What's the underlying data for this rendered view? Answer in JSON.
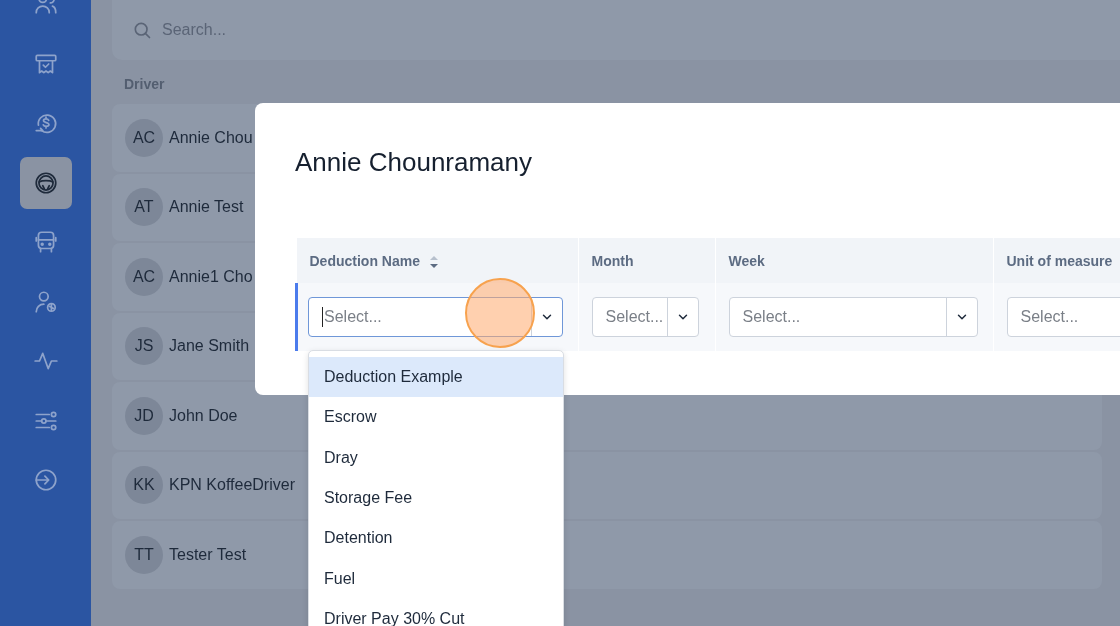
{
  "sidebar": {
    "items": [
      {
        "selected": false
      },
      {
        "selected": false
      },
      {
        "selected": false
      },
      {
        "selected": true
      },
      {
        "selected": false
      },
      {
        "selected": false
      },
      {
        "selected": false
      },
      {
        "selected": false
      },
      {
        "selected": false
      }
    ]
  },
  "search": {
    "placeholder": "Search..."
  },
  "drivers": {
    "heading": "Driver",
    "rows": [
      {
        "initials": "AC",
        "name": "Annie Chou"
      },
      {
        "initials": "AT",
        "name": "Annie Test"
      },
      {
        "initials": "AC",
        "name": "Annie1 Cho"
      },
      {
        "initials": "JS",
        "name": "Jane Smith"
      },
      {
        "initials": "JD",
        "name": "John Doe"
      },
      {
        "initials": "KK",
        "name": "KPN KoffeeDriver"
      },
      {
        "initials": "TT",
        "name": "Tester Test"
      }
    ]
  },
  "modal": {
    "title": "Annie Chounramany",
    "columns": [
      {
        "label": "Deduction Name",
        "kind": "sortable"
      },
      {
        "label": "Month",
        "kind": "plain"
      },
      {
        "label": "Week",
        "kind": "plain"
      },
      {
        "label": "Unit of measure",
        "kind": "plain"
      }
    ],
    "selects": [
      {
        "placeholder": "Select...",
        "focused": true
      },
      {
        "placeholder": "Select...",
        "focused": false
      },
      {
        "placeholder": "Select...",
        "focused": false
      },
      {
        "placeholder": "Select...",
        "focused": false
      }
    ],
    "options": [
      {
        "label": "Deduction Example",
        "selected": true
      },
      {
        "label": "Escrow",
        "selected": false
      },
      {
        "label": "Dray",
        "selected": false
      },
      {
        "label": "Storage Fee",
        "selected": false
      },
      {
        "label": "Detention",
        "selected": false
      },
      {
        "label": "Fuel",
        "selected": false
      },
      {
        "label": "Driver Pay 30% Cut",
        "selected": false
      }
    ]
  }
}
